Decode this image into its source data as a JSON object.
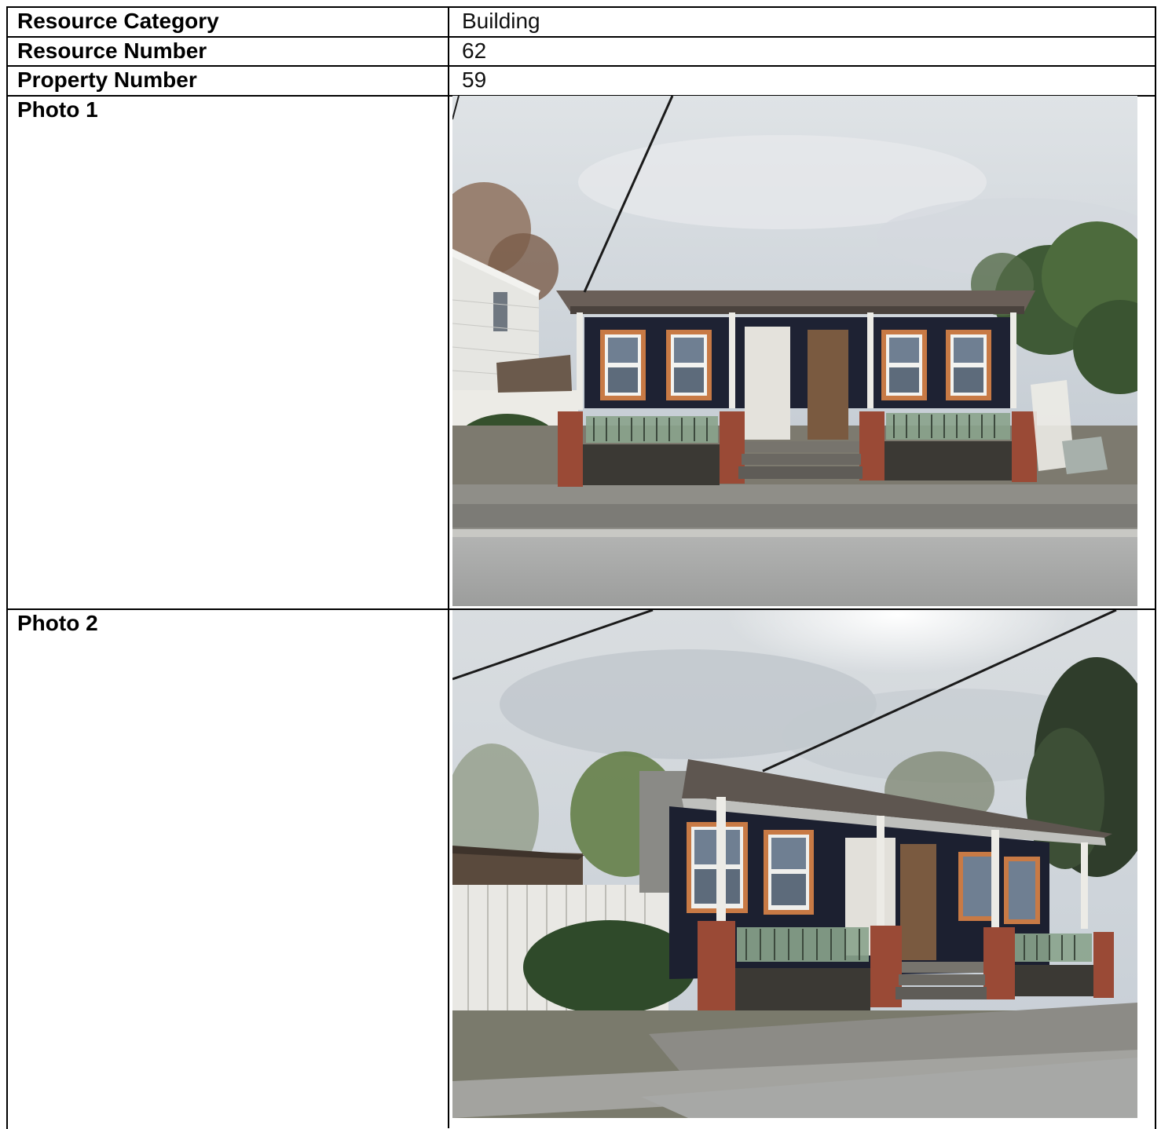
{
  "rows": [
    {
      "label": "Resource Category",
      "value": "Building"
    },
    {
      "label": "Resource Number",
      "value": "62"
    },
    {
      "label": "Property Number",
      "value": "59"
    }
  ],
  "photos": [
    {
      "label": "Photo 1"
    },
    {
      "label": "Photo 2"
    }
  ],
  "colors": {
    "border": "#000000",
    "sky": "#cdd3d8",
    "house_siding": "#1e2233",
    "brick": "#9a4a36",
    "railing": "#8aa38c",
    "trim_white": "#e8e6e0",
    "road": "#a5a6a5"
  }
}
